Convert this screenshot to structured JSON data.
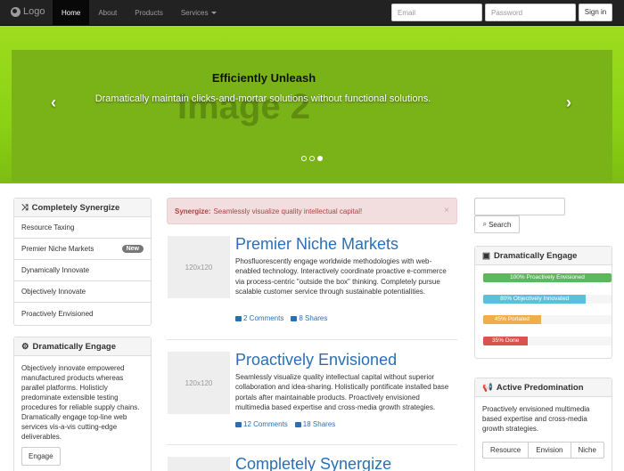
{
  "navbar": {
    "brand": "Logo",
    "items": [
      "Home",
      "About",
      "Products",
      "Services"
    ],
    "email_placeholder": "Email",
    "password_placeholder": "Password",
    "signin": "Sign in"
  },
  "carousel": {
    "image_label": "Image 2",
    "title": "Efficiently Unleash",
    "caption": "Dramatically maintain clicks-and-mortar solutions without functional solutions.",
    "prev_icon": "‹",
    "next_icon": "›",
    "slides": 3,
    "active_slide": 3
  },
  "sidebar": {
    "list_title": "Completely Synergize",
    "list_items": [
      {
        "label": "Resource Taxing",
        "badge": ""
      },
      {
        "label": "Premier Niche Markets",
        "badge": "New"
      },
      {
        "label": "Dynamically Innovate",
        "badge": ""
      },
      {
        "label": "Objectively Innovate",
        "badge": ""
      },
      {
        "label": "Proactively Envisioned",
        "badge": ""
      }
    ],
    "panel_title": "Dramatically Engage",
    "panel_text": "Objectively innovate empowered manufactured products whereas parallel platforms. Holisticly predominate extensible testing procedures for reliable supply chains. Dramatically engage top-line web services vis-a-vis cutting-edge deliverables.",
    "panel_button": "Engage"
  },
  "alert": {
    "strong": "Synergize:",
    "text": "Seamlessly visualize quality intellectual capital!",
    "close": "×"
  },
  "articles": [
    {
      "thumb": "120x120",
      "title": "Premier Niche Markets",
      "text": "Phosfluorescently engage worldwide methodologies with web-enabled technology. Interactively coordinate proactive e-commerce via process-centric \"outside the box\" thinking. Completely pursue scalable customer service through sustainable potentialities.",
      "comments": "2 Comments",
      "shares": "8 Shares"
    },
    {
      "thumb": "120x120",
      "title": "Proactively Envisioned",
      "text": "Seamlessly visualize quality intellectual capital without superior collaboration and idea-sharing. Holistically pontificate installed base portals after maintainable products. Proactively envisioned multimedia based expertise and cross-media growth strategies.",
      "comments": "12 Comments",
      "shares": "18 Shares"
    },
    {
      "thumb": "",
      "title": "Completely Synergize",
      "text": "",
      "comments": "",
      "shares": ""
    }
  ],
  "right": {
    "search_button": "Search",
    "progress_title": "Dramatically Engage",
    "progress": [
      {
        "label": "100% Proactively Envisioned",
        "value": 100,
        "color": "#5cb85c"
      },
      {
        "label": "80% Objectively Innovated",
        "value": 80,
        "color": "#5bc0de"
      },
      {
        "label": "45% Portaled",
        "value": 45,
        "color": "#f0ad4e"
      },
      {
        "label": "35% Done",
        "value": 35,
        "color": "#d9534f"
      }
    ],
    "promo_title": "Active Predomination",
    "promo_text": "Proactively envisioned multimedia based expertise and cross-media growth strategies.",
    "buttons": [
      "Resource",
      "Envision",
      "Niche"
    ]
  }
}
